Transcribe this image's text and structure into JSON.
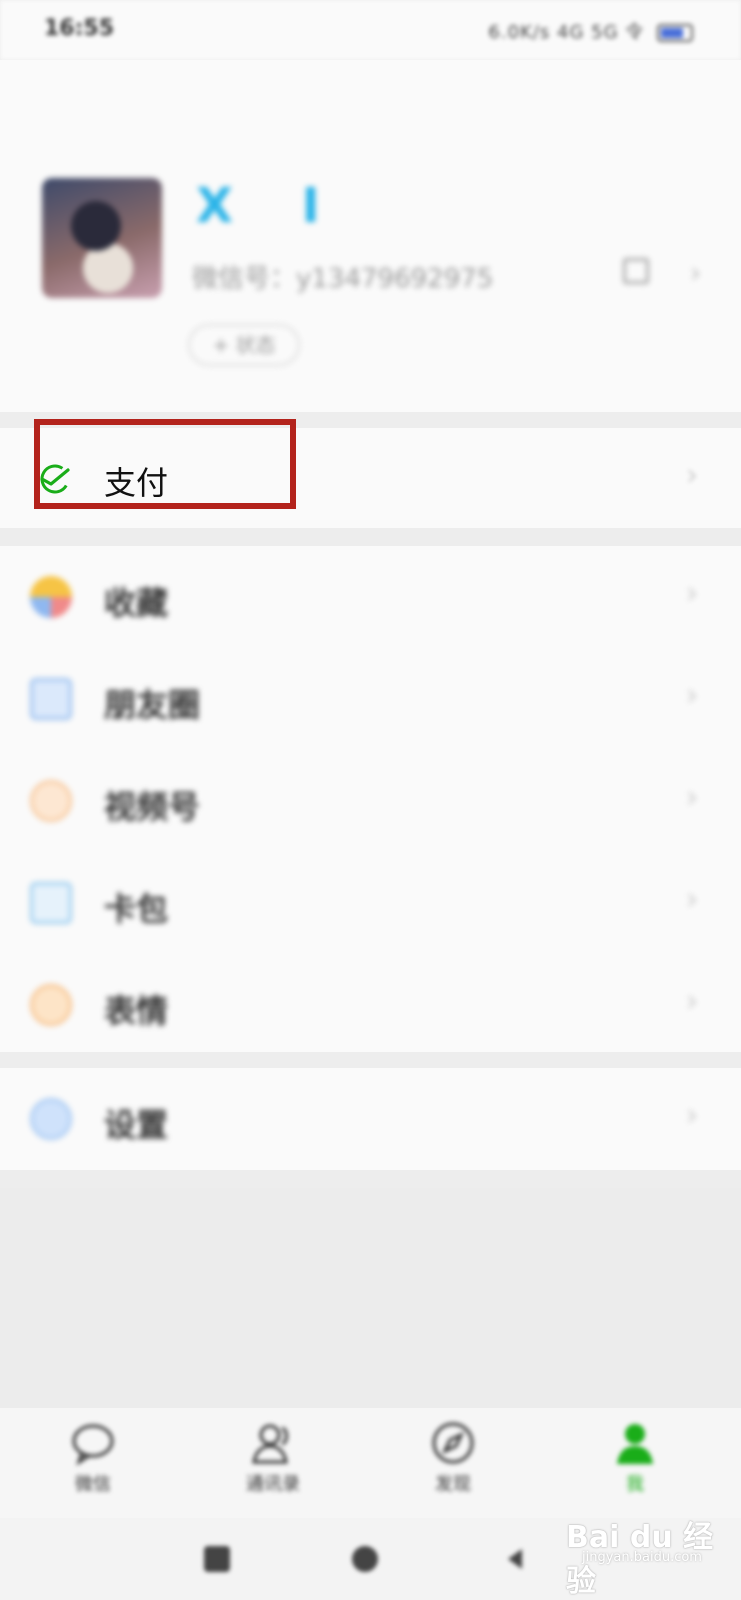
{
  "status_bar": {
    "time": "16:55",
    "indicators": "6.0K/s  4G  5G  令"
  },
  "profile": {
    "nickname": "X  I",
    "wechat_id": "微信号：y13479692975",
    "status_button": "+ 状态"
  },
  "menu": {
    "pay": {
      "label": "支付",
      "icon": "wechat-pay-icon",
      "accent": "#1aad19"
    },
    "group1": [
      {
        "label": "收藏",
        "icon": "favorites-icon"
      },
      {
        "label": "朋友圈",
        "icon": "moments-icon"
      },
      {
        "label": "视频号",
        "icon": "channels-icon"
      },
      {
        "label": "卡包",
        "icon": "card-wallet-icon"
      },
      {
        "label": "表情",
        "icon": "sticker-icon"
      }
    ],
    "settings": {
      "label": "设置",
      "icon": "settings-icon"
    }
  },
  "highlight_color": "#b3231c",
  "tab_bar": {
    "tabs": [
      {
        "label": "微信",
        "icon": "chat-icon",
        "active": false
      },
      {
        "label": "通讯录",
        "icon": "contacts-icon",
        "active": false
      },
      {
        "label": "发现",
        "icon": "discover-icon",
        "active": false
      },
      {
        "label": "我",
        "icon": "me-icon",
        "active": true
      }
    ]
  },
  "watermark": {
    "brand": "Bai du 经验",
    "url": "jingyan.baidu.com"
  }
}
